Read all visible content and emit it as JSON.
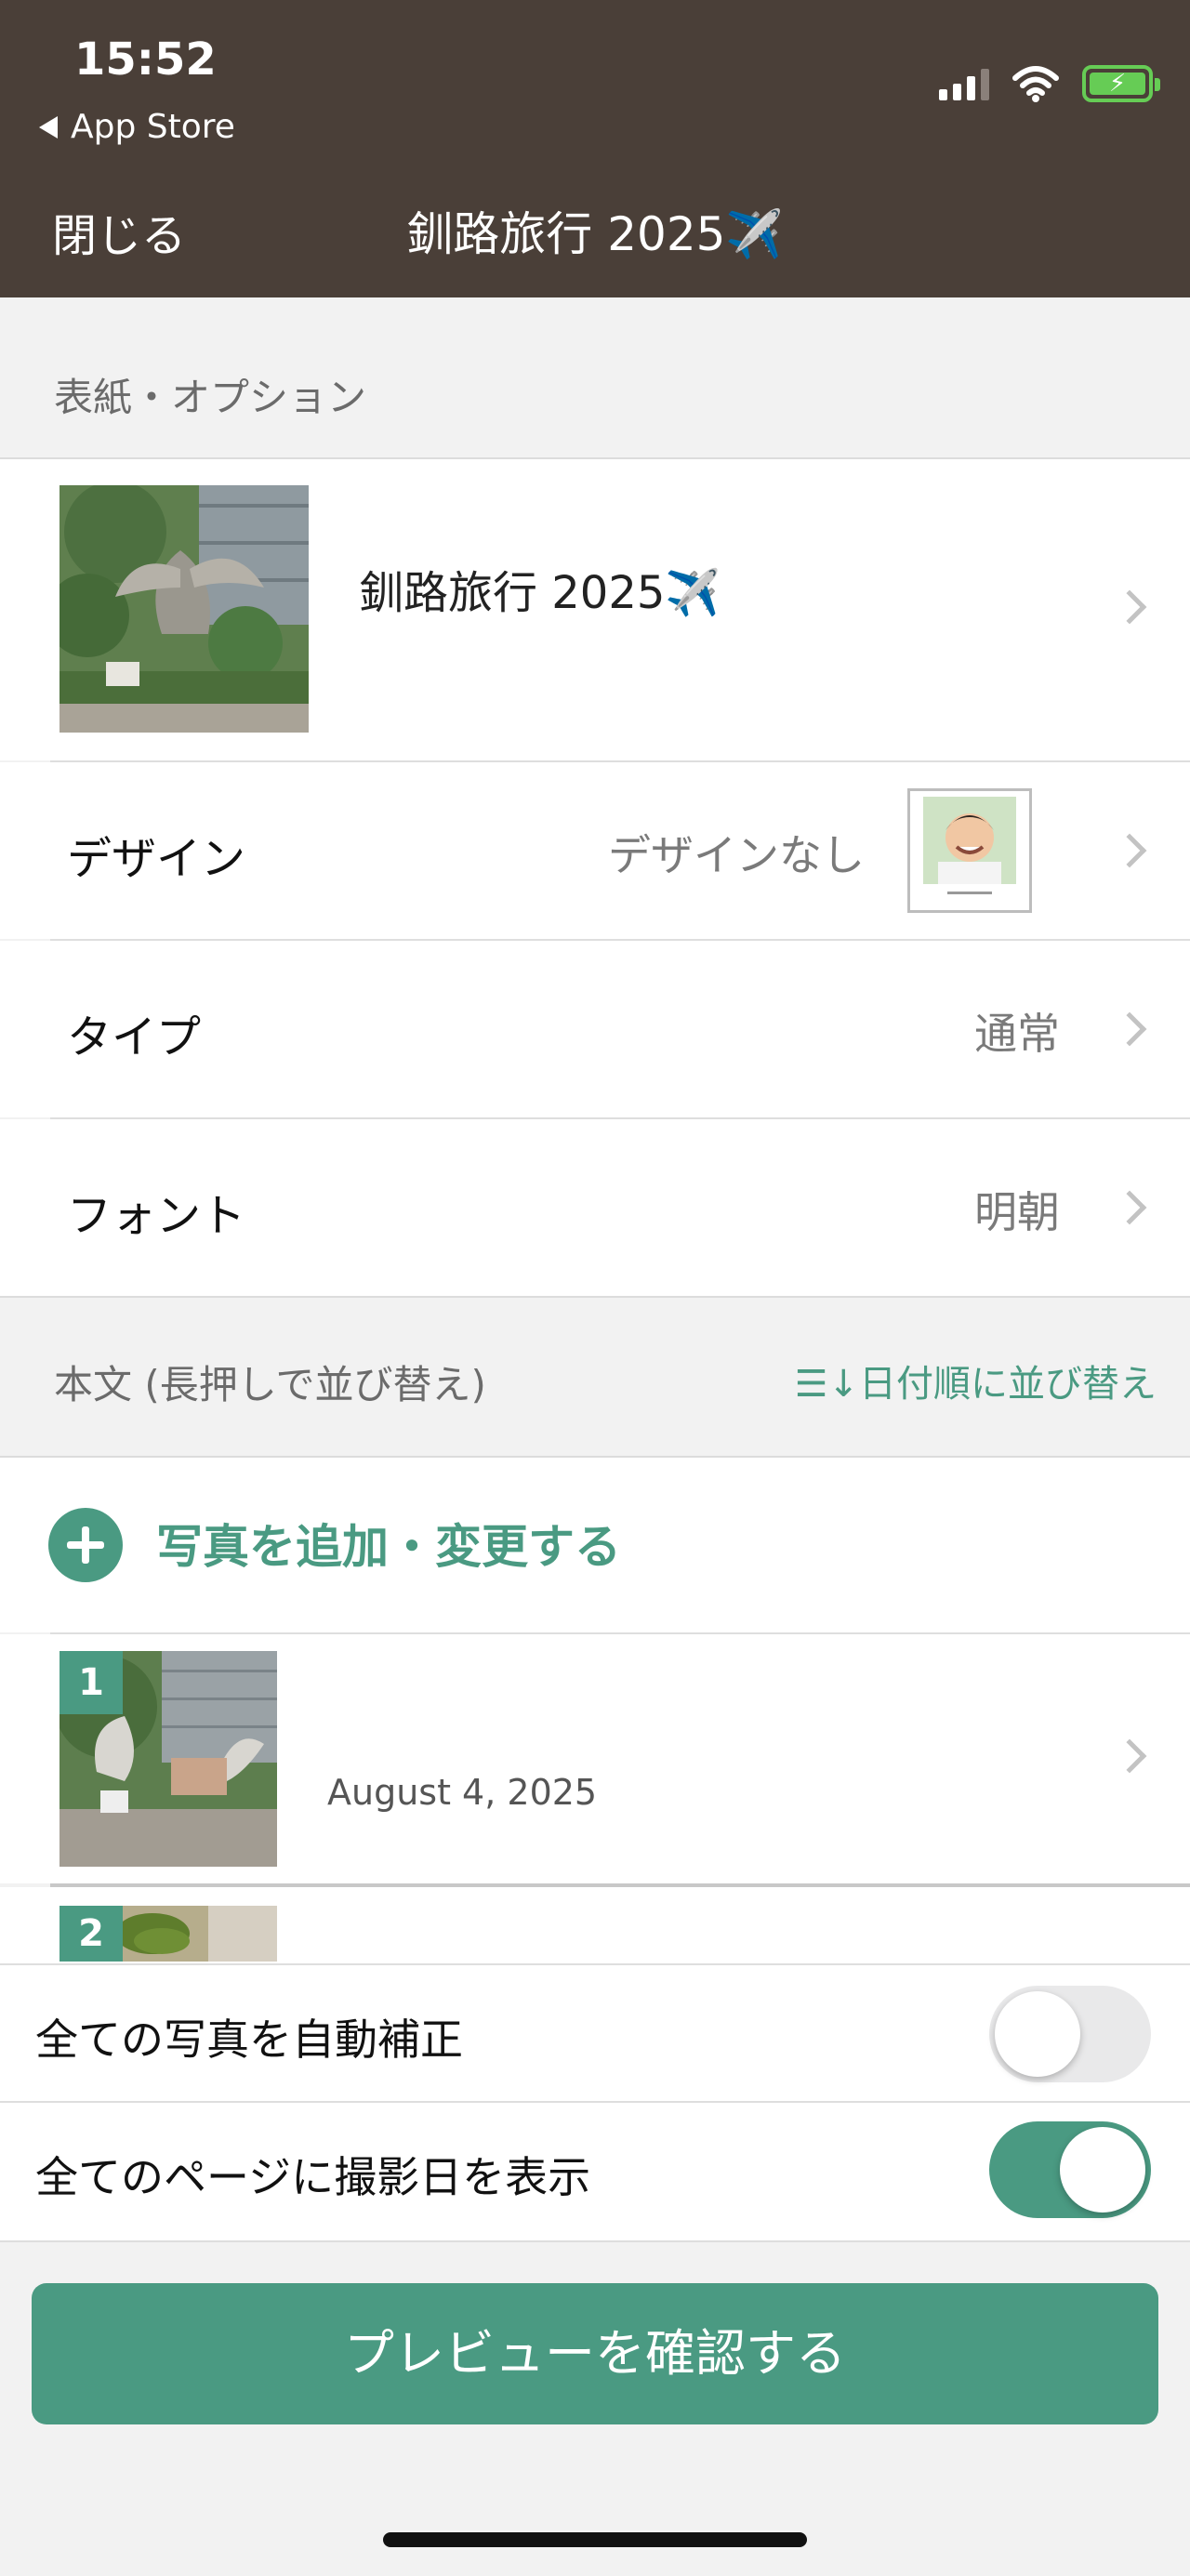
{
  "status_bar": {
    "time": "15:52",
    "back_label": "App Store"
  },
  "nav": {
    "close_label": "閉じる",
    "title": "釧路旅行 2025✈️"
  },
  "cover_section": {
    "header": "表紙・オプション",
    "cover_title": "釧路旅行 2025✈️",
    "rows": [
      {
        "label": "デザイン",
        "value": "デザインなし"
      },
      {
        "label": "タイプ",
        "value": "通常"
      },
      {
        "label": "フォント",
        "value": "明朝"
      }
    ]
  },
  "body_section": {
    "header": "本文 (長押しで並び替え)",
    "sort_label": "☰↓日付順に並び替え",
    "add_label": "写真を追加・変更する",
    "pages": [
      {
        "number": "1",
        "date": "August 4, 2025"
      },
      {
        "number": "2",
        "date": ""
      }
    ]
  },
  "settings": [
    {
      "label": "全ての写真を自動補正",
      "on": false
    },
    {
      "label": "全てのページに撮影日を表示",
      "on": true
    }
  ],
  "preview_button": "プレビューを確認する",
  "colors": {
    "header_bg": "#4a3f38",
    "accent": "#4a9a82",
    "battery": "#66cc55"
  }
}
